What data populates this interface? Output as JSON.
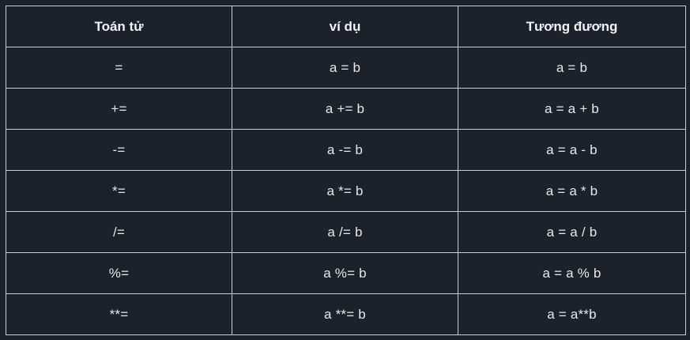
{
  "table": {
    "headers": [
      "Toán tử",
      "ví dụ",
      "Tương đương"
    ],
    "rows": [
      [
        "=",
        "a = b",
        "a = b"
      ],
      [
        "+=",
        "a += b",
        "a = a + b"
      ],
      [
        "-=",
        "a -= b",
        "a = a - b"
      ],
      [
        "*=",
        "a *= b",
        "a = a * b"
      ],
      [
        "/=",
        "a /= b",
        "a = a / b"
      ],
      [
        "%=",
        "a %= b",
        "a = a % b"
      ],
      [
        "**=",
        "a **= b",
        "a = a**b"
      ]
    ]
  }
}
